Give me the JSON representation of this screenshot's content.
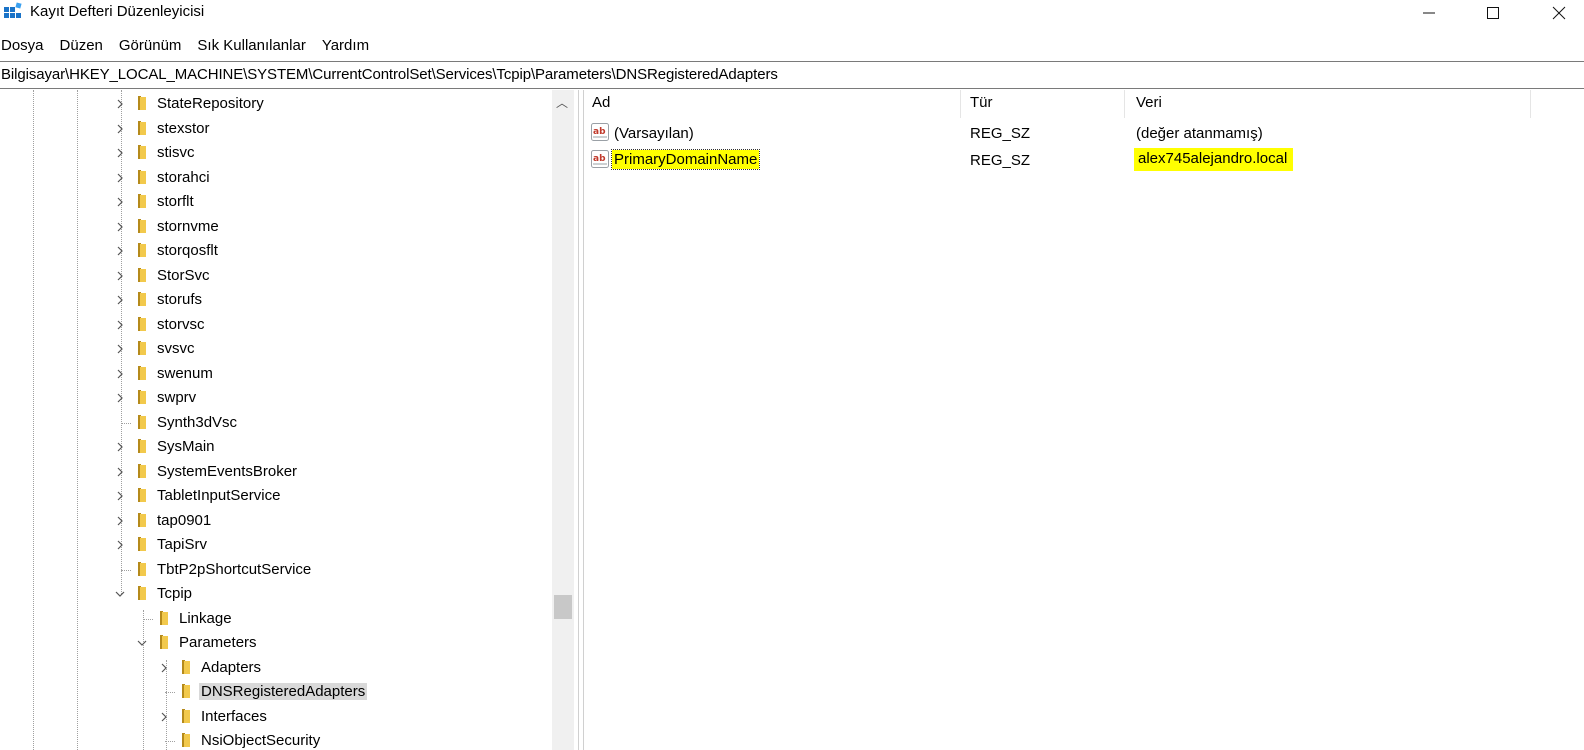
{
  "window": {
    "title": "Kayıt Defteri Düzenleyicisi",
    "controls": {
      "minimize": "—",
      "maximize": "☐",
      "close": "✕"
    }
  },
  "menu": [
    "Dosya",
    "Düzen",
    "Görünüm",
    "Sık Kullanılanlar",
    "Yardım"
  ],
  "address": "Bilgisayar\\HKEY_LOCAL_MACHINE\\SYSTEM\\CurrentControlSet\\Services\\Tcpip\\Parameters\\DNSRegisteredAdapters",
  "tree": {
    "items": [
      {
        "label": "StateRepository",
        "expander": "collapsed"
      },
      {
        "label": "stexstor",
        "expander": "collapsed"
      },
      {
        "label": "stisvc",
        "expander": "collapsed"
      },
      {
        "label": "storahci",
        "expander": "collapsed"
      },
      {
        "label": "storflt",
        "expander": "collapsed"
      },
      {
        "label": "stornvme",
        "expander": "collapsed"
      },
      {
        "label": "storqosflt",
        "expander": "collapsed"
      },
      {
        "label": "StorSvc",
        "expander": "collapsed"
      },
      {
        "label": "storufs",
        "expander": "collapsed"
      },
      {
        "label": "storvsc",
        "expander": "collapsed"
      },
      {
        "label": "svsvc",
        "expander": "collapsed"
      },
      {
        "label": "swenum",
        "expander": "collapsed"
      },
      {
        "label": "swprv",
        "expander": "collapsed"
      },
      {
        "label": "Synth3dVsc",
        "expander": "none"
      },
      {
        "label": "SysMain",
        "expander": "collapsed"
      },
      {
        "label": "SystemEventsBroker",
        "expander": "collapsed"
      },
      {
        "label": "TabletInputService",
        "expander": "collapsed"
      },
      {
        "label": "tap0901",
        "expander": "collapsed"
      },
      {
        "label": "TapiSrv",
        "expander": "collapsed"
      },
      {
        "label": "TbtP2pShortcutService",
        "expander": "none"
      },
      {
        "label": "Tcpip",
        "expander": "expanded"
      },
      {
        "label": "Linkage",
        "expander": "none"
      },
      {
        "label": "Parameters",
        "expander": "expanded"
      },
      {
        "label": "Adapters",
        "expander": "collapsed"
      },
      {
        "label": "DNSRegisteredAdapters",
        "expander": "none",
        "selected": true
      },
      {
        "label": "Interfaces",
        "expander": "collapsed"
      },
      {
        "label": "NsiObjectSecurity",
        "expander": "none"
      }
    ]
  },
  "list": {
    "columns": [
      "Ad",
      "Tür",
      "Veri"
    ],
    "rows": [
      {
        "name": "(Varsayılan)",
        "type": "REG_SZ",
        "data": "(değer atanmamış)"
      },
      {
        "name": "PrimaryDomainName",
        "type": "REG_SZ",
        "data": "alex745alejandro.local",
        "highlighted": true
      }
    ]
  },
  "colors": {
    "highlight": "#ffff00",
    "selection": "#d9d9d9",
    "folder": "#f2c94c"
  }
}
